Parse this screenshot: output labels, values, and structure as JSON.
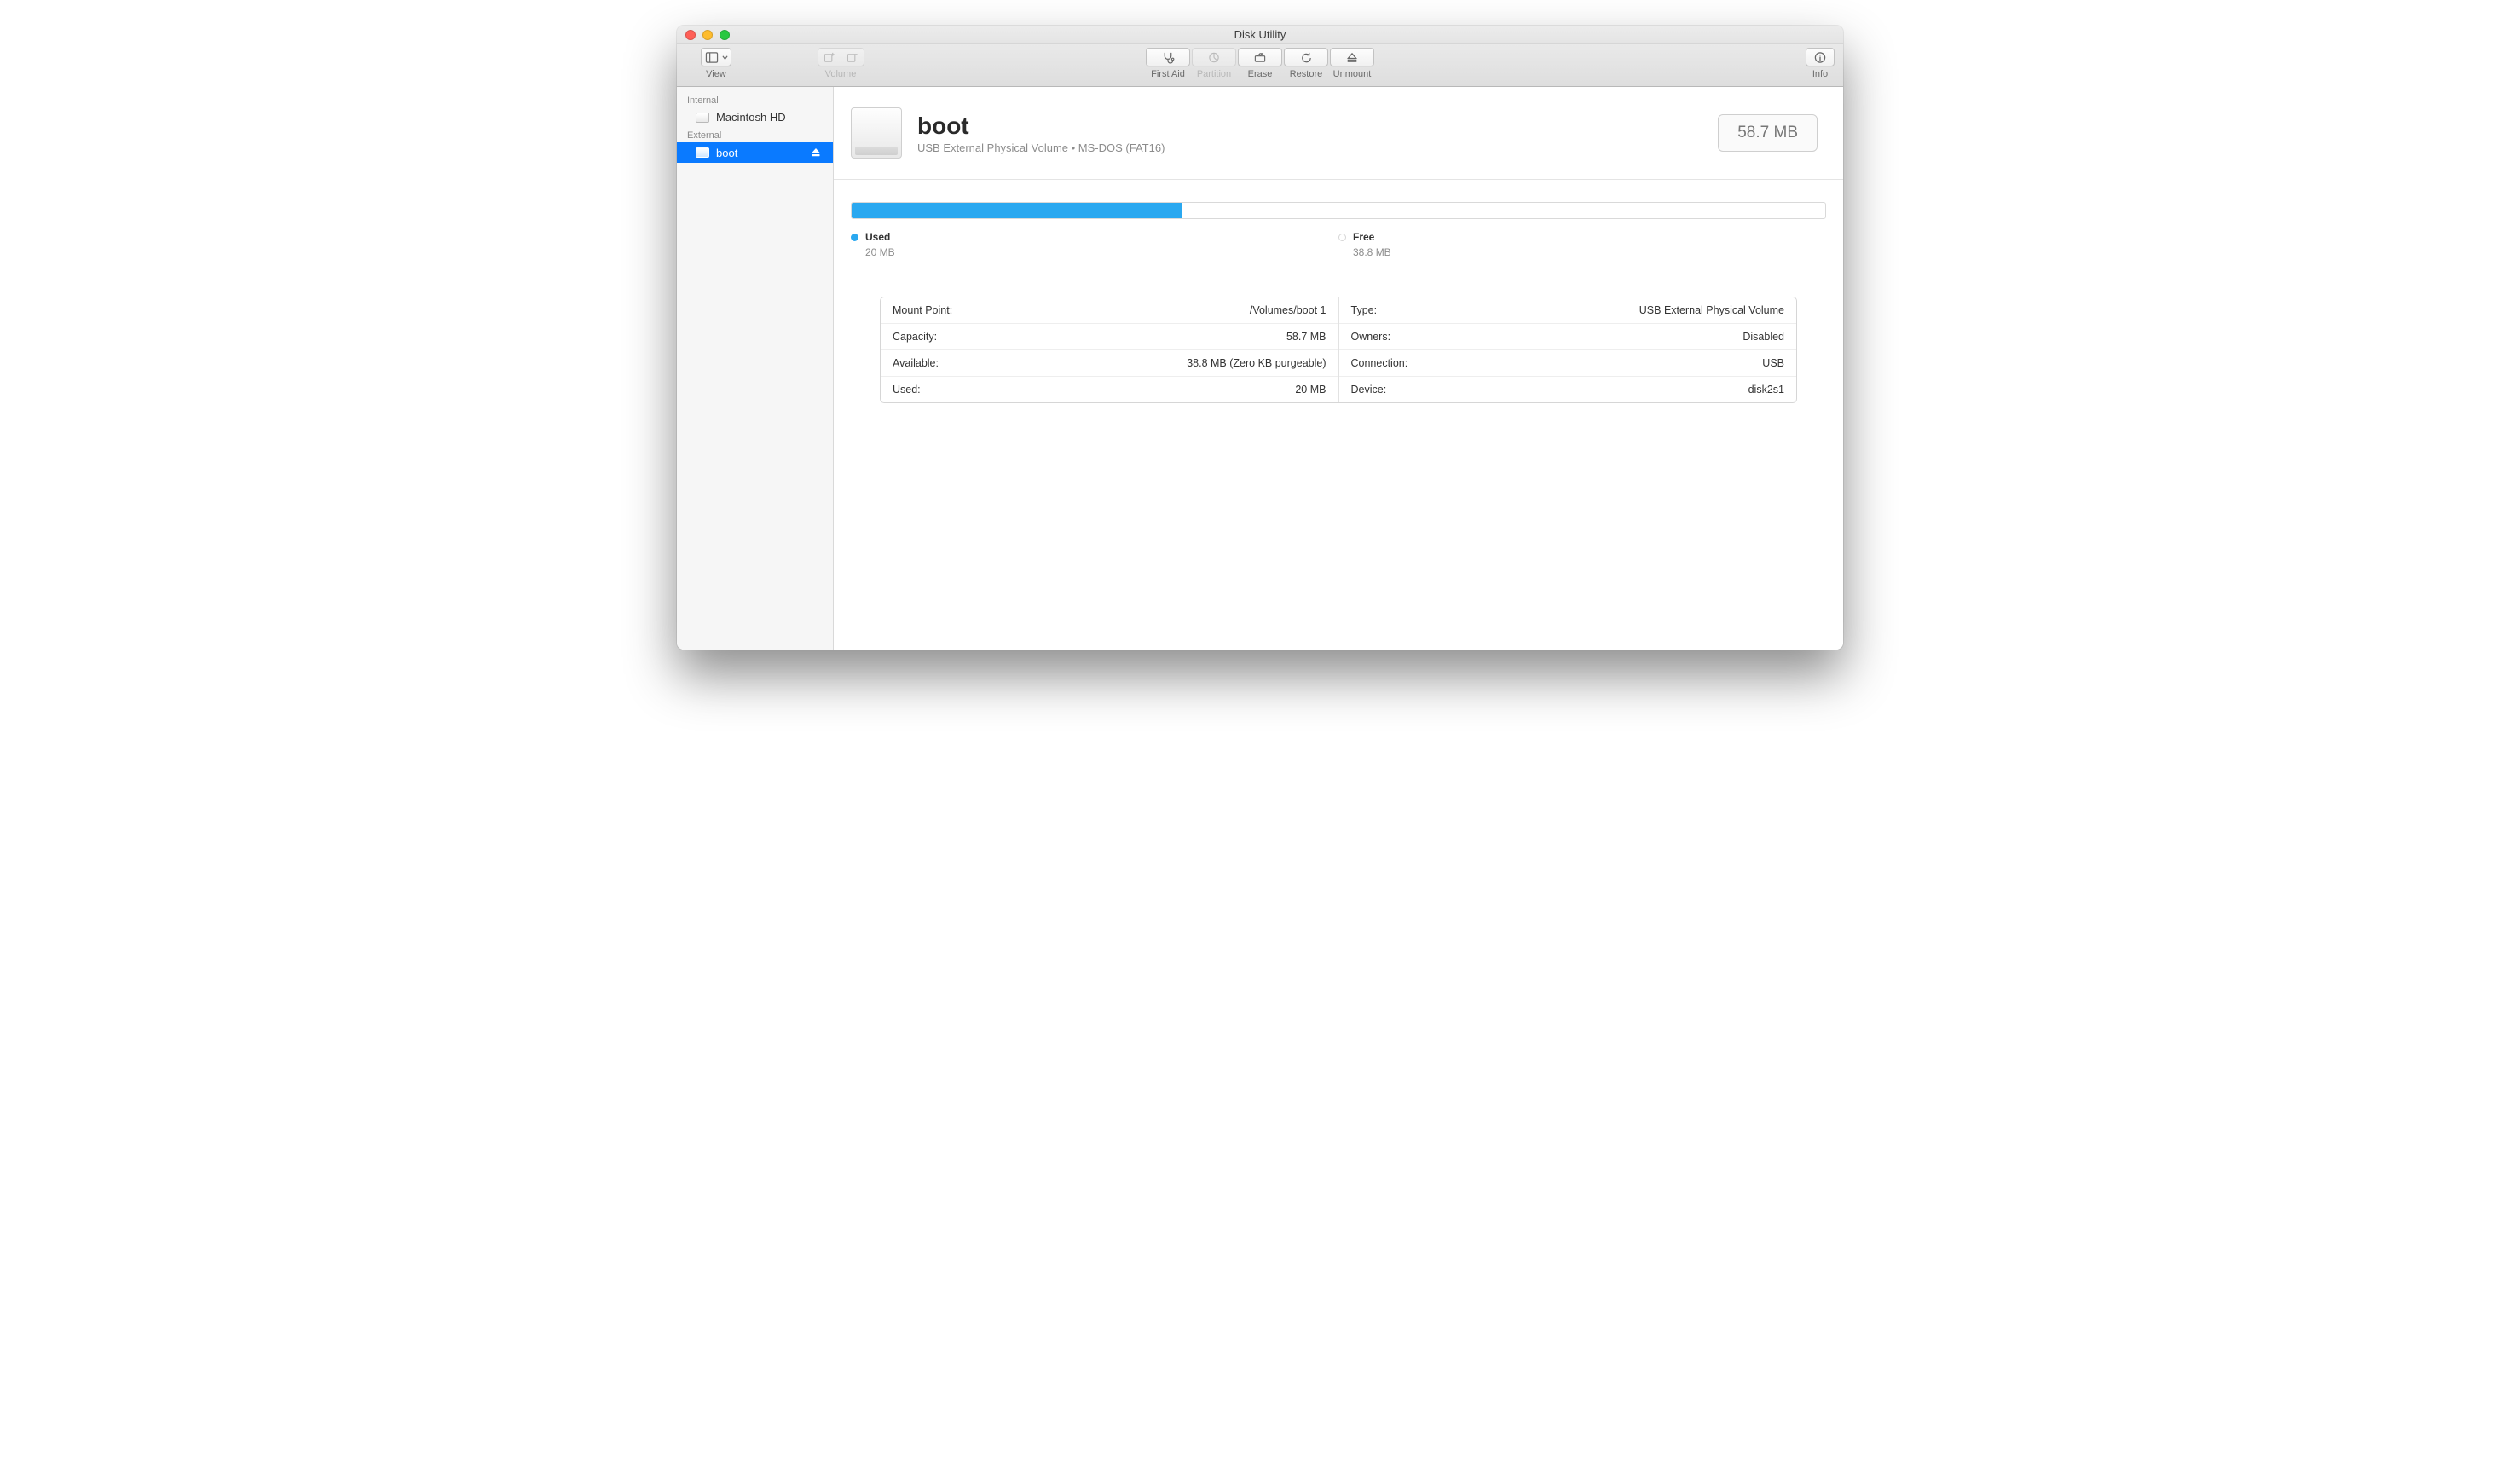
{
  "window": {
    "title": "Disk Utility"
  },
  "toolbar": {
    "view_label": "View",
    "volume_label": "Volume",
    "first_aid": "First Aid",
    "partition": "Partition",
    "erase": "Erase",
    "restore": "Restore",
    "unmount": "Unmount",
    "info": "Info"
  },
  "sidebar": {
    "internal_header": "Internal",
    "external_header": "External",
    "internal_items": [
      {
        "label": "Macintosh HD"
      }
    ],
    "external_items": [
      {
        "label": "boot"
      }
    ]
  },
  "volume": {
    "name": "boot",
    "subtitle": "USB External Physical Volume • MS-DOS (FAT16)",
    "size_display": "58.7 MB"
  },
  "usage": {
    "used_label": "Used",
    "used_value": "20 MB",
    "free_label": "Free",
    "free_value": "38.8 MB",
    "used_percent": 34
  },
  "details": {
    "left": [
      {
        "k": "Mount Point:",
        "v": "/Volumes/boot 1"
      },
      {
        "k": "Capacity:",
        "v": "58.7 MB"
      },
      {
        "k": "Available:",
        "v": "38.8 MB (Zero KB purgeable)"
      },
      {
        "k": "Used:",
        "v": "20 MB"
      }
    ],
    "right": [
      {
        "k": "Type:",
        "v": "USB External Physical Volume"
      },
      {
        "k": "Owners:",
        "v": "Disabled"
      },
      {
        "k": "Connection:",
        "v": "USB"
      },
      {
        "k": "Device:",
        "v": "disk2s1"
      }
    ]
  }
}
